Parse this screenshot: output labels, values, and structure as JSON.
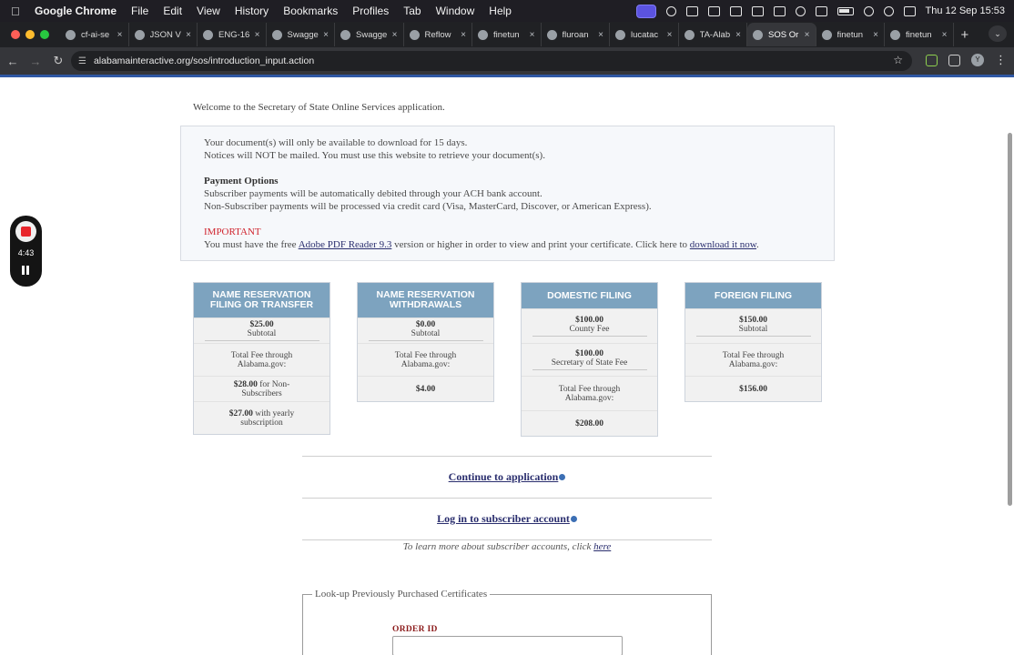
{
  "menubar": {
    "app_name": "Google Chrome",
    "items": [
      "File",
      "Edit",
      "View",
      "History",
      "Bookmarks",
      "Profiles",
      "Tab",
      "Window",
      "Help"
    ],
    "clock": "Thu 12 Sep  15:53"
  },
  "tabs": [
    {
      "label": "cf-ai-se",
      "icon": "github-icon"
    },
    {
      "label": "JSON V",
      "icon": "json-icon"
    },
    {
      "label": "ENG-16",
      "icon": "linear-icon"
    },
    {
      "label": "Swagge",
      "icon": "swagger-icon"
    },
    {
      "label": "Swagge",
      "icon": "swagger-icon"
    },
    {
      "label": "Reflow",
      "icon": "app-icon"
    },
    {
      "label": "finetun",
      "icon": "finetune-icon"
    },
    {
      "label": "fluroan",
      "icon": "google-icon"
    },
    {
      "label": "lucatac",
      "icon": "doc-icon"
    },
    {
      "label": "TA-Alab",
      "icon": "shield-icon"
    },
    {
      "label": "SOS Or",
      "icon": "globe-icon",
      "active": true
    },
    {
      "label": "finetun",
      "icon": "finetune-icon"
    },
    {
      "label": "finetun",
      "icon": "finetune-icon"
    }
  ],
  "toolbar": {
    "url": "alabamainteractive.org/sos/introduction_input.action",
    "avatar_letter": "Y"
  },
  "page": {
    "welcome": "Welcome to the Secretary of State Online Services application.",
    "info": {
      "line1": "Your document(s) will only be available to download for 15 days.",
      "line2": "Notices will NOT be mailed. You must use this website to retrieve your document(s).",
      "payment_heading": "Payment Options",
      "payment_line1": "Subscriber payments will be automatically debited through your ACH bank account.",
      "payment_line2": "Non-Subscriber payments will be processed via credit card (Visa, MasterCard, Discover, or American Express).",
      "important_heading": "IMPORTANT",
      "important_pre": "You must have the free ",
      "adobe_link": "Adobe PDF Reader 9.3",
      "important_mid": " version or higher in order to view and print your certificate. Click here to ",
      "download_link": "download it now",
      "important_post": "."
    },
    "fee_boxes": [
      {
        "header": "NAME RESERVATION FILING OR TRANSFER",
        "rows": [
          {
            "amount": "$25.00",
            "label": "Subtotal",
            "underline": true
          },
          {
            "text": "Total Fee through Alabama.gov:"
          },
          {
            "amount": "$28.00",
            "suffix": " for Non-Subscribers"
          },
          {
            "amount": "$27.00",
            "suffix": " with yearly subscription"
          }
        ]
      },
      {
        "header": "NAME RESERVATION WITHDRAWALS",
        "rows": [
          {
            "amount": "$0.00",
            "label": "Subtotal",
            "underline": true
          },
          {
            "text": "Total Fee through Alabama.gov:"
          },
          {
            "amount": "$4.00"
          }
        ]
      },
      {
        "header": "DOMESTIC FILING",
        "rows": [
          {
            "amount": "$100.00",
            "label": "County Fee",
            "underline": true
          },
          {
            "amount": "$100.00",
            "label": "Secretary of State Fee",
            "underline": true
          },
          {
            "text": "Total Fee through Alabama.gov:"
          },
          {
            "amount": "$208.00"
          }
        ]
      },
      {
        "header": "FOREIGN FILING",
        "rows": [
          {
            "amount": "$150.00",
            "label": "Subtotal",
            "underline": true
          },
          {
            "text": "Total Fee through Alabama.gov:"
          },
          {
            "amount": "$156.00"
          }
        ]
      }
    ],
    "continue_link": "Continue to application",
    "login_link": "Log in to subscriber account",
    "learn_more_text": "To learn more about subscriber accounts, click ",
    "learn_more_link": "here",
    "lookup_legend": "Look-up Previously Purchased Certificates",
    "order_id_label": "ORDER ID"
  },
  "recorder": {
    "time": "4:43"
  },
  "colors": {
    "fee_header": "#7da3bf",
    "important": "#d0252f",
    "link": "#2a2e6e",
    "page_topbar": "#2f58a4"
  }
}
